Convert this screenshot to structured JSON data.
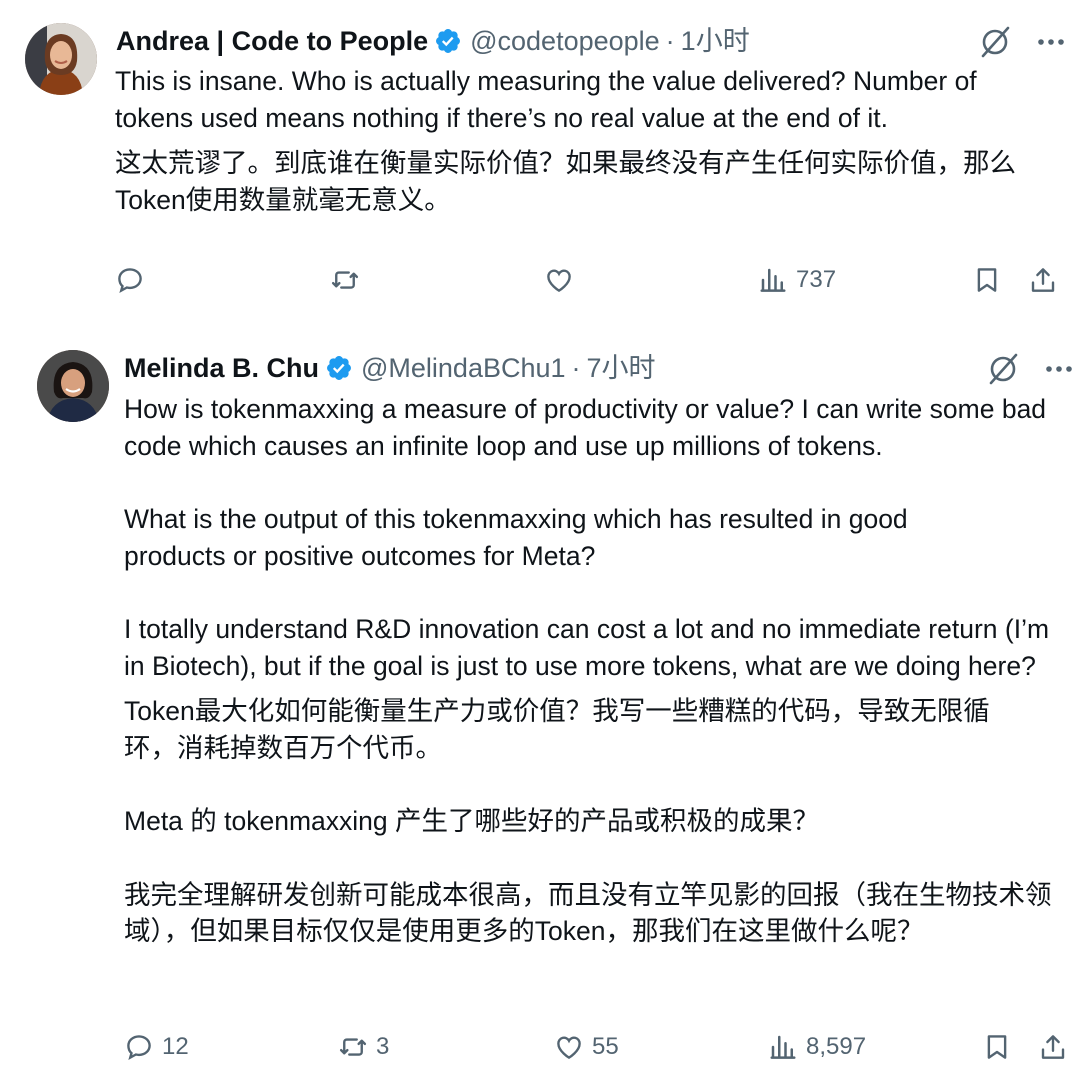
{
  "tweets": [
    {
      "author": {
        "name": "Andrea | Code to People",
        "handle": "@codetopeople",
        "time": "1小时"
      },
      "body": [
        "This is insane. Who is actually measuring the value delivered? Number of tokens used means nothing if there’s no real value at the end of it.",
        "这太荒谬了。到底谁在衡量实际价值？如果最终没有产生任何实际价值，那么Token使用数量就毫无意义。"
      ],
      "actions": {
        "replies": "",
        "retweets": "",
        "likes": "",
        "views": "737"
      }
    },
    {
      "author": {
        "name": "Melinda B. Chu",
        "handle": "@MelindaBChu1",
        "time": "7小时"
      },
      "body": [
        "How is tokenmaxxing a measure of productivity or value?  I can write some bad code which causes an infinite loop and use up millions of tokens.",
        "What is the output of this tokenmaxxing which has resulted in good products or positive outcomes for Meta?",
        "I totally understand R&D innovation can cost a lot and no immediate return (I’m in Biotech), but if the goal is just to use more tokens, what are we doing here?",
        "Token最大化如何能衡量生产力或价值？我写一些糟糕的代码，导致无限循环，消耗掉数百万个代币。",
        "Meta 的 tokenmaxxing 产生了哪些好的产品或积极的成果？",
        "我完全理解研发创新可能成本很高，而且没有立竿见影的回报（我在生物技术领域），但如果目标仅仅是使用更多的Token，那我们在这里做什么呢？"
      ],
      "actions": {
        "replies": "12",
        "retweets": "3",
        "likes": "55",
        "views": "8,597"
      }
    }
  ],
  "header_separator": "·",
  "colors": {
    "text": "#0f1419",
    "secondary": "#536471",
    "verified": "#1d9bf0"
  },
  "icons": [
    "verified-badge-icon",
    "grok-icon",
    "more-icon",
    "reply-icon",
    "retweet-icon",
    "like-icon",
    "views-icon",
    "bookmark-icon",
    "share-icon"
  ]
}
